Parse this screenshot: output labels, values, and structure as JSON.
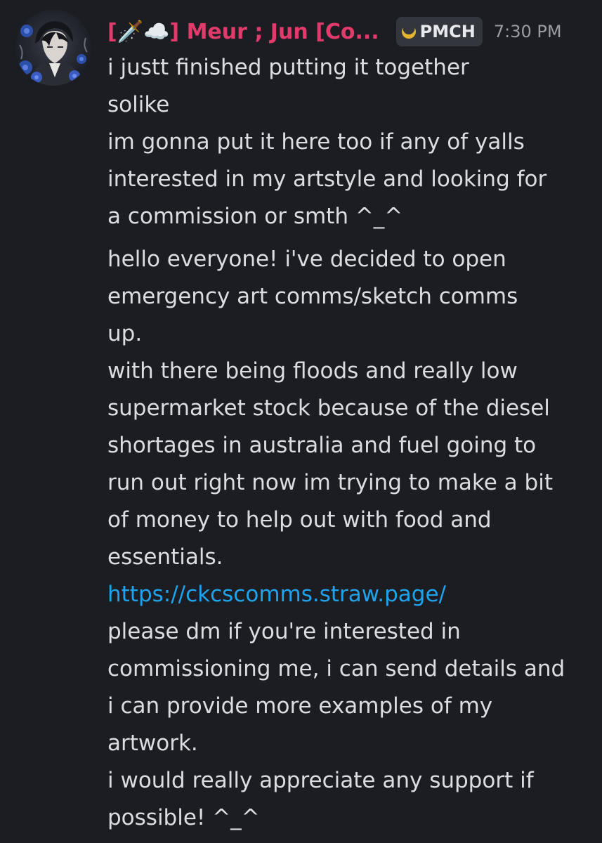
{
  "message": {
    "author": {
      "display_name": "[🗡️☁️] Meur ; Jun [Co...",
      "guild_tag": "PMCH",
      "tag_icon": "crescent-moon-icon"
    },
    "timestamp": "7:30 PM",
    "lines": [
      "i justt finished putting it together",
      "solike",
      "im gonna put it here too if any of yalls",
      "interested in my artstyle and looking for",
      "a commission or smth ^_^"
    ],
    "quoted_lines": [
      "hello everyone! i've decided to open",
      "emergency art comms/sketch comms",
      "up.",
      "with there being floods and really low",
      "supermarket stock because of the diesel",
      "shortages in australia and fuel going to",
      "run out right now im trying to make a bit",
      "of money to help out with food and",
      "essentials."
    ],
    "link": "https://ckcscomms.straw.page/",
    "closing_lines": [
      "please dm if you're interested in",
      "commissioning me, i can send details and",
      "i can provide more examples of my",
      "artwork.",
      "i would really appreciate any support if",
      "possible! ^_^"
    ]
  },
  "colors": {
    "background": "#1c1d22",
    "username": "#e23a6b",
    "link": "#1fa3ec",
    "text": "#dcdde1",
    "timestamp": "#9a9ca4"
  }
}
